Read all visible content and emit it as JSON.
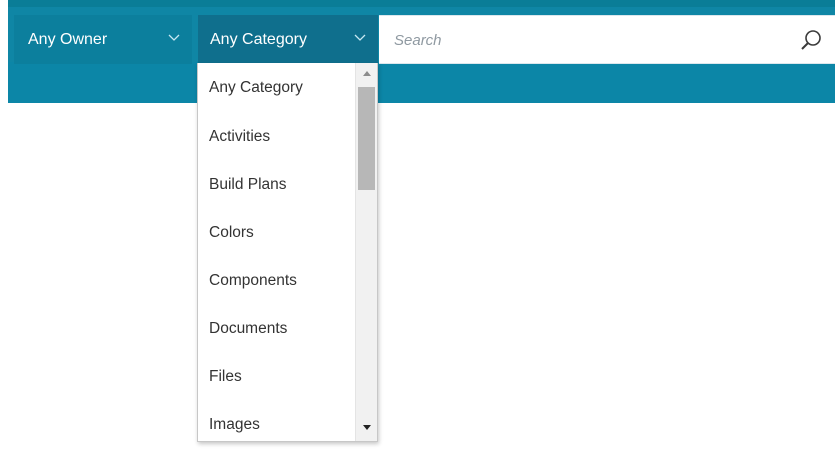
{
  "filters": {
    "owner": {
      "label": "Any Owner"
    },
    "category": {
      "label": "Any Category"
    },
    "search": {
      "placeholder": "Search",
      "value": ""
    }
  },
  "category_dropdown": {
    "options": [
      "Any Category",
      "Activities",
      "Build Plans",
      "Colors",
      "Components",
      "Documents",
      "Files",
      "Images"
    ]
  },
  "icons": {
    "owner_dropdown": "chevron-down-icon",
    "category_dropdown": "chevron-down-icon",
    "search": "search-icon",
    "scroll_up": "scroll-up-arrow-icon",
    "scroll_down": "scroll-down-arrow-icon"
  },
  "colors": {
    "toolbar": "#0f86a5",
    "owner_button": "#0c7f9d",
    "category_button": "#0f6f8d",
    "menu_text": "#333333",
    "search_text": "#8f99a1"
  }
}
